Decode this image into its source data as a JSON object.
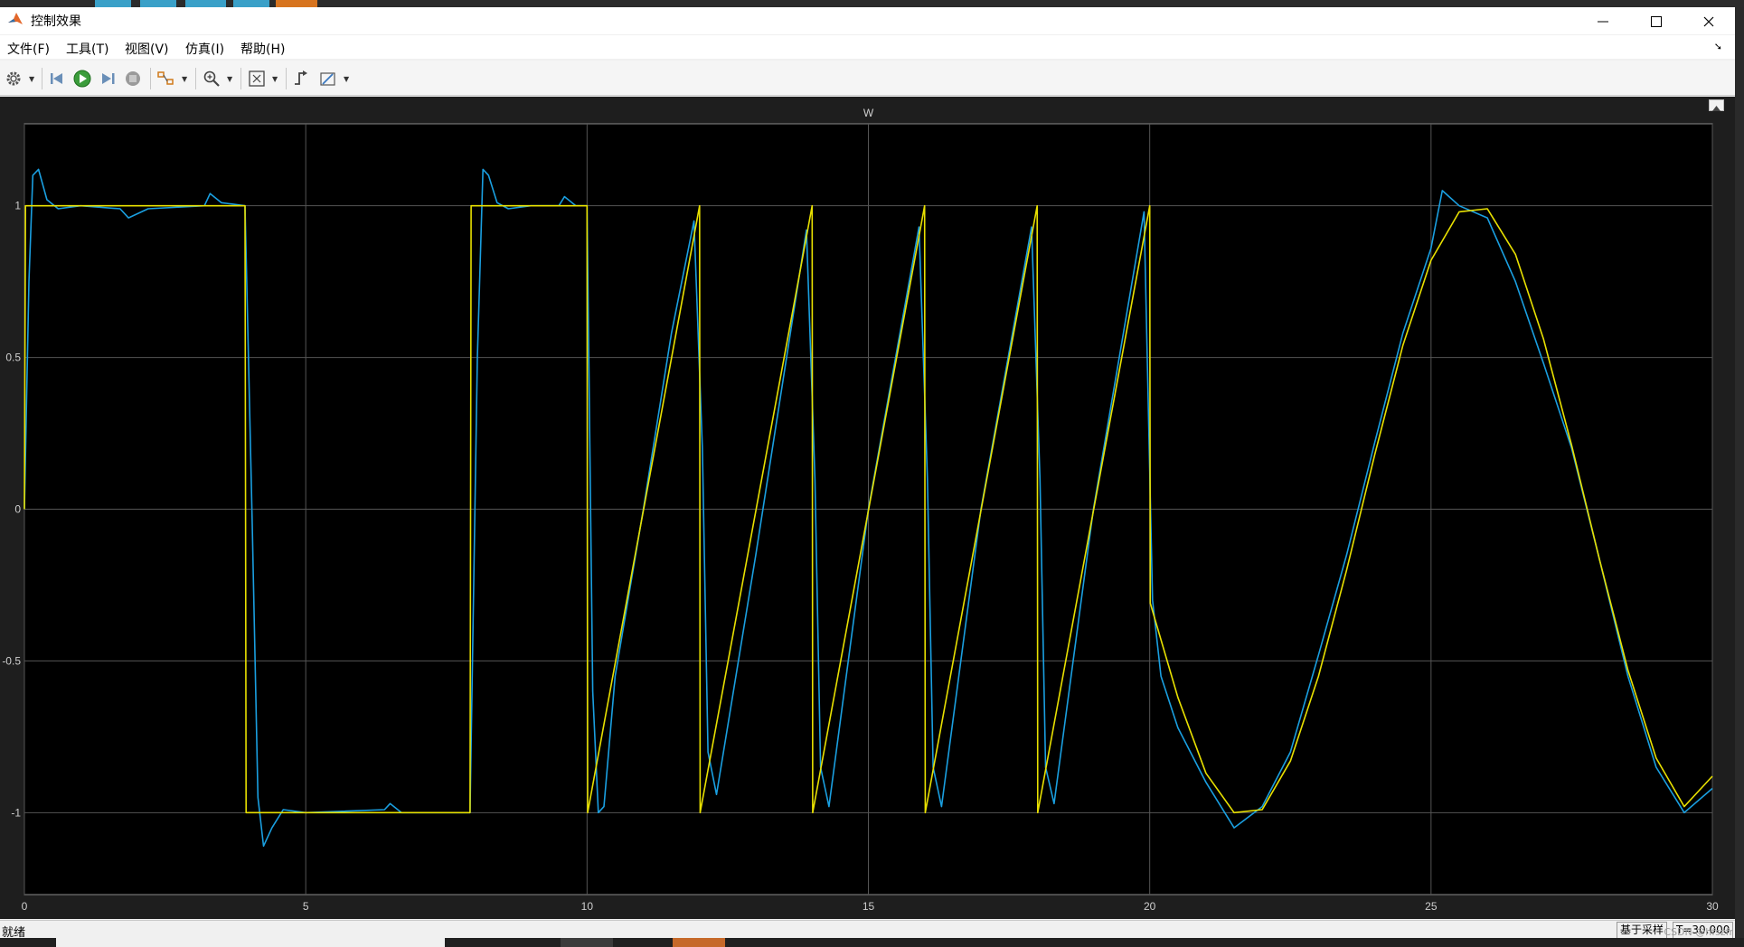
{
  "window": {
    "title": "控制效果"
  },
  "menu": [
    "文件(F)",
    "工具(T)",
    "视图(V)",
    "仿真(I)",
    "帮助(H)"
  ],
  "toolbar": [
    "gear-icon",
    "step-back-icon",
    "run-icon",
    "step-forward-icon",
    "stop-icon",
    "highlight-icon",
    "zoom-in-icon",
    "fit-to-view-icon",
    "trigger-icon",
    "cursor-measure-icon"
  ],
  "status": {
    "ready": "就绪",
    "sample_based": "基于采样",
    "time": "T=30.000"
  },
  "watermark": "CSDN @hfszfr",
  "colors": {
    "plot_bg": "#000000",
    "reference_series": "#e8e000",
    "response_series": "#1a9fe0",
    "grid": "#555555",
    "axes_text": "#cfcfcf"
  },
  "chart_data": {
    "type": "line",
    "title": "W",
    "xlabel": "",
    "ylabel": "",
    "xlim": [
      0,
      30
    ],
    "ylim": [
      -1.27,
      1.27
    ],
    "xticks": [
      0,
      5,
      10,
      15,
      20,
      25,
      30
    ],
    "yticks": [
      -1,
      -0.5,
      0,
      0.5,
      1
    ],
    "ytick_labels": [
      "-1",
      "-0.5",
      "0",
      "0.5",
      "1"
    ],
    "grid": true,
    "legend": "none",
    "series": [
      {
        "color": "#e8e000",
        "x": [
          0,
          0.02,
          3.92,
          3.94,
          7.92,
          7.94,
          10,
          10.01,
          12,
          12.01,
          14,
          14.01,
          16,
          16.01,
          18,
          18.01,
          20,
          20.01,
          20.5,
          21,
          21.5,
          22,
          22.5,
          23,
          23.5,
          24,
          24.5,
          25,
          25.5,
          26,
          26.5,
          27,
          27.5,
          28,
          28.5,
          29,
          29.5,
          30
        ],
        "values": [
          0,
          1,
          1,
          -1,
          -1,
          1,
          1,
          -1,
          1,
          -1,
          1,
          -1,
          1,
          -1,
          1,
          -1,
          1,
          -0.31,
          -0.62,
          -0.87,
          -1.0,
          -0.99,
          -0.83,
          -0.55,
          -0.2,
          0.18,
          0.54,
          0.82,
          0.98,
          0.99,
          0.84,
          0.56,
          0.21,
          -0.17,
          -0.53,
          -0.82,
          -0.98,
          -0.88
        ]
      },
      {
        "color": "#1a9fe0",
        "x": [
          0,
          0.08,
          0.15,
          0.25,
          0.4,
          0.6,
          1.0,
          1.7,
          1.85,
          2.2,
          3.2,
          3.3,
          3.5,
          3.92,
          4.05,
          4.15,
          4.25,
          4.4,
          4.6,
          5.0,
          6.4,
          6.5,
          6.7,
          7.92,
          8.05,
          8.15,
          8.25,
          8.4,
          8.6,
          9.0,
          9.5,
          9.6,
          9.8,
          10.0,
          10.1,
          10.2,
          10.3,
          10.5,
          11.0,
          11.5,
          11.9,
          12.05,
          12.15,
          12.3,
          13.0,
          13.9,
          14.05,
          14.15,
          14.3,
          15.0,
          15.9,
          16.05,
          16.15,
          16.3,
          17.0,
          17.9,
          18.05,
          18.15,
          18.3,
          19.0,
          19.9,
          20.05,
          20.2,
          20.5,
          21.0,
          21.5,
          22.0,
          22.5,
          23.0,
          23.5,
          24.0,
          24.5,
          25.0,
          25.2,
          25.5,
          26.0,
          26.5,
          27.0,
          27.5,
          28.0,
          28.5,
          29.0,
          29.5,
          30.0
        ],
        "values": [
          0,
          0.75,
          1.1,
          1.12,
          1.02,
          0.99,
          1.0,
          0.99,
          0.96,
          0.99,
          1.0,
          1.04,
          1.01,
          1.0,
          -0.05,
          -0.95,
          -1.11,
          -1.05,
          -0.99,
          -1.0,
          -0.99,
          -0.97,
          -1.0,
          -1.0,
          0.5,
          1.12,
          1.1,
          1.01,
          0.99,
          1.0,
          1.0,
          1.03,
          1.0,
          1.0,
          -0.6,
          -1.0,
          -0.98,
          -0.55,
          0.0,
          0.58,
          0.95,
          0.2,
          -0.8,
          -0.94,
          -0.15,
          0.92,
          0.1,
          -0.85,
          -0.98,
          0.0,
          0.93,
          0.1,
          -0.85,
          -0.98,
          0.0,
          0.93,
          0.1,
          -0.85,
          -0.97,
          0.0,
          0.98,
          -0.3,
          -0.55,
          -0.72,
          -0.9,
          -1.05,
          -0.98,
          -0.8,
          -0.48,
          -0.15,
          0.22,
          0.58,
          0.86,
          1.05,
          1.0,
          0.96,
          0.75,
          0.48,
          0.2,
          -0.17,
          -0.55,
          -0.85,
          -1.0,
          -0.92
        ]
      }
    ]
  }
}
